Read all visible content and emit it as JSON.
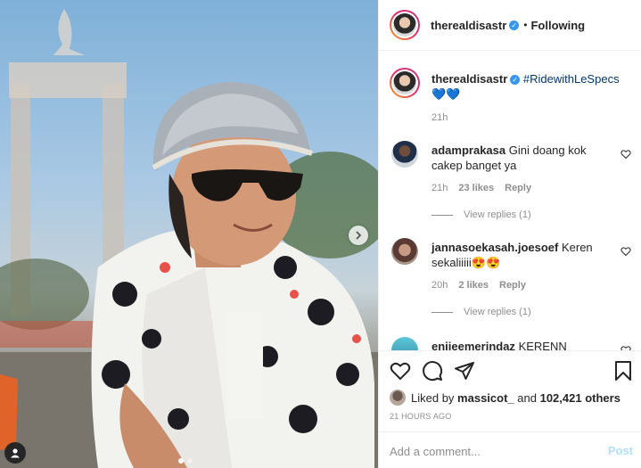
{
  "post": {
    "username": "therealdisastr",
    "follow_state": "Following",
    "separator": "•",
    "caption_hashtag": "#RidewithLeSpecs",
    "caption_emoji": "💙💙",
    "caption_time": "21h",
    "carousel_position": 1,
    "carousel_total": 2
  },
  "comments": [
    {
      "username": "adamprakasa",
      "text": "Gini doang kok cakep banget ya",
      "time": "21h",
      "likes": "23 likes",
      "reply_label": "Reply",
      "view_replies": "View replies (1)"
    },
    {
      "username": "jannasoekasah.joesoef",
      "text": "Keren sekaliiiii😍😍",
      "time": "20h",
      "likes": "2 likes",
      "reply_label": "Reply",
      "view_replies": "View replies (1)"
    },
    {
      "username": "enjieemerindaz",
      "text": "KERENN"
    }
  ],
  "likes": {
    "prefix": "Liked by",
    "first_user": "massicot_",
    "conjunction": "and",
    "others": "102,421 others"
  },
  "timestamp": "21 HOURS AGO",
  "add_comment": {
    "placeholder": "Add a comment...",
    "post_label": "Post"
  },
  "icons": {
    "like": "heart-icon",
    "comment": "comment-icon",
    "share": "share-icon",
    "save": "bookmark-icon",
    "next": "chevron-right-icon",
    "tags": "user-tag-icon",
    "verified": "verified-badge-icon"
  },
  "colors": {
    "link": "#00376b",
    "verified": "#3897f0",
    "post_disabled": "#b2dffc",
    "muted": "#8e8e8e"
  }
}
